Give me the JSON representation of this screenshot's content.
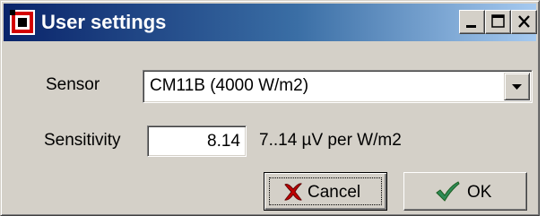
{
  "window": {
    "title": "User settings",
    "icon": "app-icon"
  },
  "caption_buttons": {
    "minimize": "minimize-icon",
    "maximize": "maximize-icon",
    "close": "close-icon"
  },
  "form": {
    "sensor_label": "Sensor",
    "sensor_value": "CM11B (4000 W/m2)",
    "sensitivity_label": "Sensitivity",
    "sensitivity_value": "8.14",
    "sensitivity_unit": "7..14 µV per W/m2"
  },
  "buttons": {
    "cancel_label": "Cancel",
    "cancel_icon": "cancel-x-icon",
    "ok_label": "OK",
    "ok_icon": "checkmark-icon"
  },
  "colors": {
    "titlebar_start": "#0a246a",
    "titlebar_end": "#a6caf0",
    "face": "#d4d0c8",
    "cancel_icon": "#c00000",
    "ok_icon": "#2e8b57"
  }
}
